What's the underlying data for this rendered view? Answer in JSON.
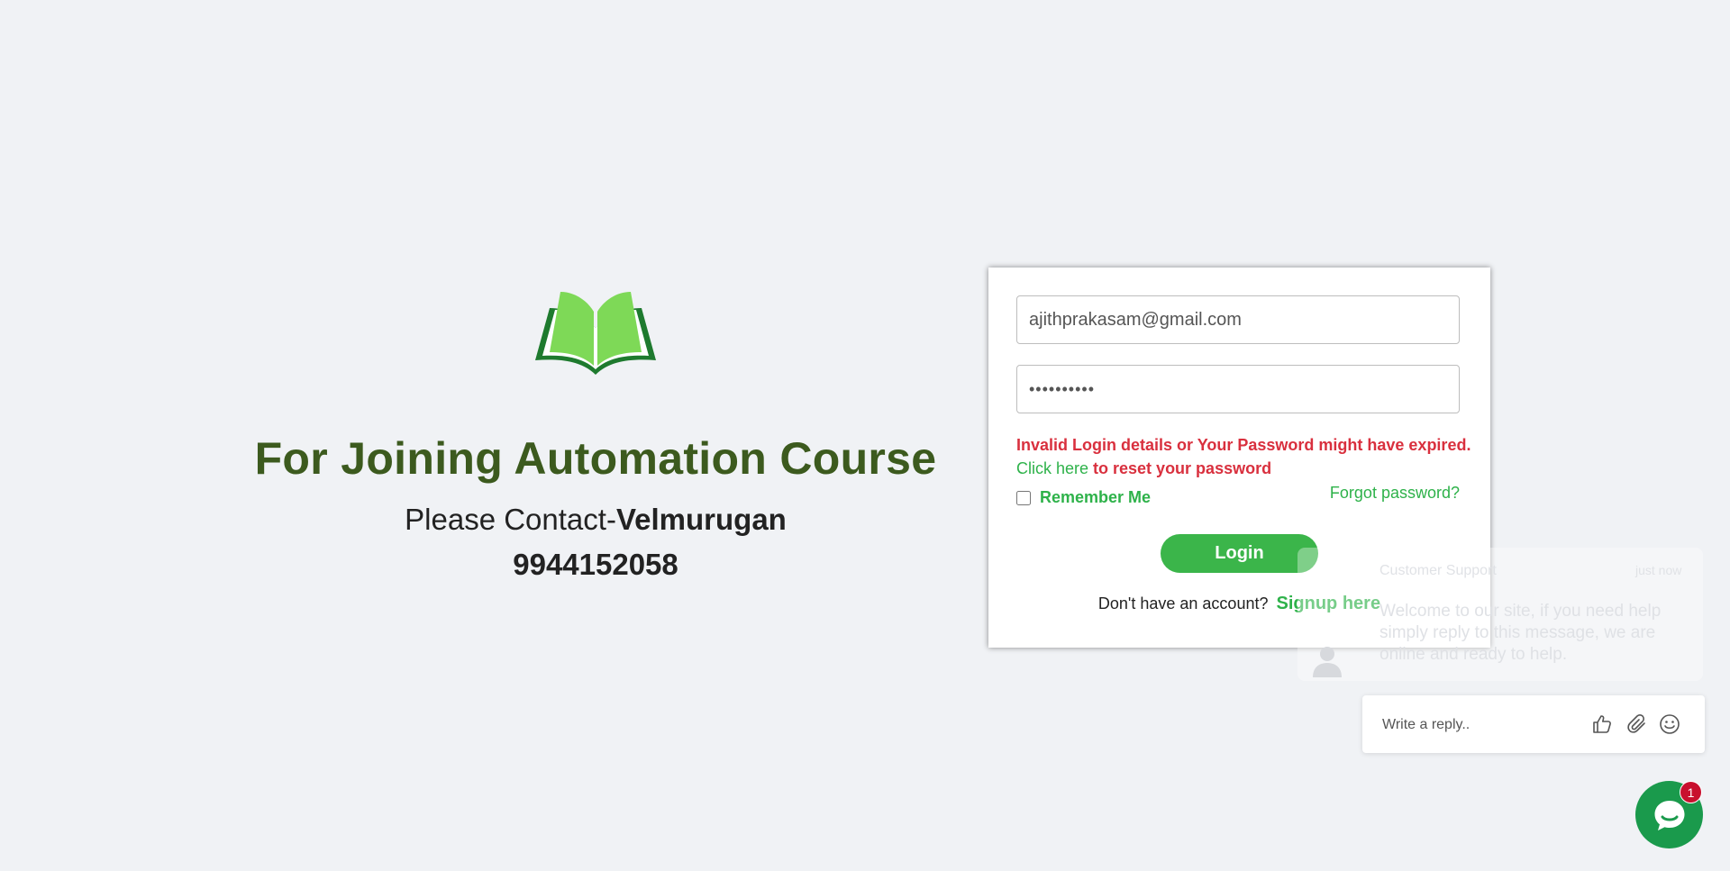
{
  "promo": {
    "headline": "For Joining Automation Course",
    "contact_prefix": "Please Contact-",
    "contact_name": "Velmurugan",
    "phone": "9944152058"
  },
  "login": {
    "email_value": "ajithprakasam@gmail.com",
    "password_value": "••••••••••",
    "error_text": "Invalid Login details or Your Password might have expired.",
    "reset_link": "Click here",
    "reset_text": " to reset your password",
    "remember_label": "Remember Me",
    "forgot_label": "Forgot password?",
    "login_button": "Login",
    "signup_prompt": "Don't have an account?",
    "signup_link": "Signup here"
  },
  "chat": {
    "agent_name": "Customer Support",
    "time": "just now",
    "message": "Welcome to our site, if you need help simply reply to this message, we are online and ready to help.",
    "reply_placeholder": "Write a reply..",
    "badge_count": "1",
    "icons": [
      "thumbs-up-icon",
      "paperclip-icon",
      "smile-icon",
      "chat-launcher-icon"
    ]
  },
  "colors": {
    "headline": "#3c5a1e",
    "accent_green": "#3bb54a",
    "error_red": "#d9303e",
    "launcher": "#1a9a4c",
    "badge": "#c8102e"
  }
}
